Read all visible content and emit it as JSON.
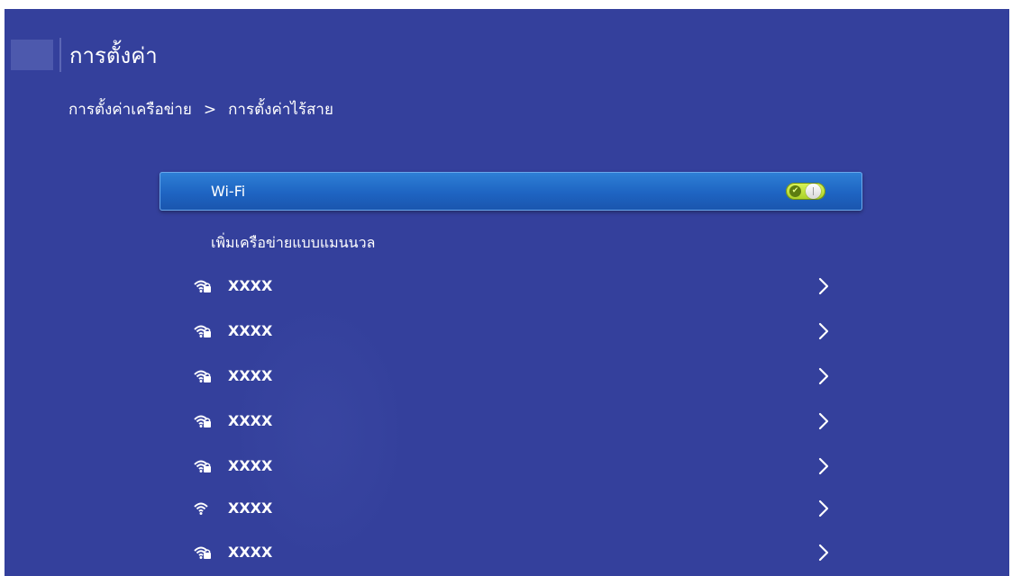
{
  "header": {
    "title": "การตั้งค่า"
  },
  "breadcrumb": {
    "parent": "การตั้งค่าเครือข่าย",
    "separator": ">",
    "current": "การตั้งค่าไร้สาย"
  },
  "wifi": {
    "label": "Wi-Fi",
    "enabled": true
  },
  "manual_add": {
    "label": "เพิ่มเครือข่ายแบบแมนนวล"
  },
  "networks": [
    {
      "name": "XXXX",
      "icon": "wifi-lock-icon",
      "secured": true
    },
    {
      "name": "XXXX",
      "icon": "wifi-lock-icon",
      "secured": true
    },
    {
      "name": "XXXX",
      "icon": "wifi-lock-icon",
      "secured": true
    },
    {
      "name": "XXXX",
      "icon": "wifi-lock-icon",
      "secured": true
    },
    {
      "name": "XXXX",
      "icon": "wifi-lock-icon",
      "secured": true
    },
    {
      "name": "XXXX",
      "icon": "wifi-icon",
      "secured": false
    },
    {
      "name": "XXXX",
      "icon": "wifi-lock-icon",
      "secured": true
    }
  ],
  "colors": {
    "background": "#34409c",
    "selected_row": "#1e64c2",
    "toggle_on": "#b8dc32",
    "text": "#ffffff"
  }
}
